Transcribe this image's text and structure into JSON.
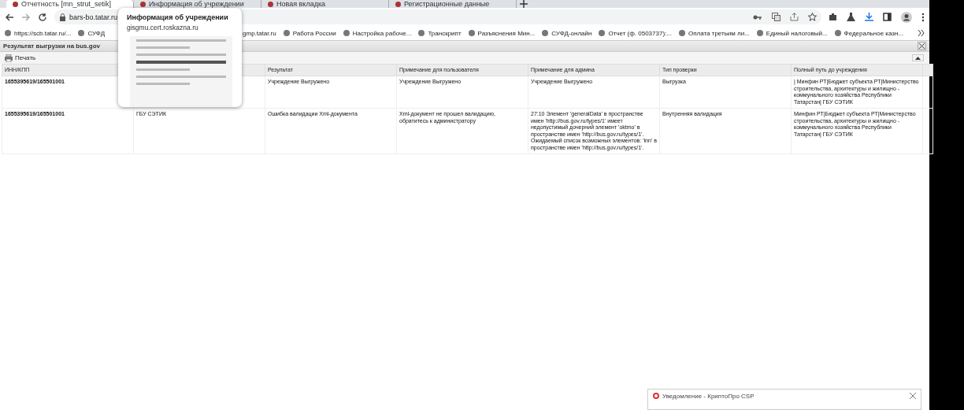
{
  "tabs": [
    {
      "title": "Отчетность [mn_strut_setik]",
      "selected": true
    },
    {
      "title": "Информация об учреждении",
      "selected": false
    },
    {
      "title": "Новая вкладка",
      "selected": false
    },
    {
      "title": "Регистрационные данные",
      "selected": false
    }
  ],
  "address": "bars-bo.tatar.ru",
  "bookmarks": [
    "https://scb.tatar.ru/...",
    "СУФД",
    "gmp.tatar.ru",
    "Работа России",
    "Настройка рабоче...",
    "Транскрипт",
    "Разъяснения Мин...",
    "СУФД-онлайн",
    "Отчет (ф. 0503737):...",
    "Оплата третьим ли...",
    "Единый налоговый...",
    "Федеральное казн..."
  ],
  "tab_preview": {
    "title": "Информация об учреждении",
    "url": "gisgmu.cert.roskazna.ru"
  },
  "panel": {
    "title": "Результат выгрузки на bus.gov",
    "print_button": "Печать"
  },
  "table": {
    "columns": [
      "ИНН/КПП",
      null,
      "Результат",
      "Примечание для пользователя",
      "Примечание для админа",
      "Тип проверки",
      "Полный путь до учреждения"
    ],
    "rows": [
      {
        "cells": [
          "1655395619/165501001",
          null,
          "Учреждение Выгружено",
          "Учреждение Выгружено",
          "Учреждение Выгружено",
          "Выгрузка",
          "| Минфин РТ|Бюджет субъекта РТ|Министерство строительства, архитектуры и жилищно - коммунального хозяйства Республики Татарстан| ГБУ СЭТИК"
        ]
      },
      {
        "cells": [
          "1655395619/165501001",
          "ГБУ СЭТИК",
          "Ошибка валидации Xml-документа",
          "Xml-документ не прошел валидацию, обратитесь к администратору",
          "27:10 Элемент 'generalData' в пространстве имен 'http://bus.gov.ru/types/1' имеет недопустимый дочерний элемент 'oktmo' в пространстве имен 'http://bus.gov.ru/types/1'. Ожидаемый список возможных элементов: 'inn' в пространстве имен 'http://bus.gov.ru/types/1'.",
          "Внутренняя валидация",
          "Минфин РТ|Бюджет субъекта РТ|Министерство строительства, архитектуры и жилищно - коммунального хозяйства Республики Татарстан| ГБУ СЭТИК"
        ]
      }
    ]
  },
  "notification": {
    "title": "Уведомление - КриптоПро CSP"
  }
}
